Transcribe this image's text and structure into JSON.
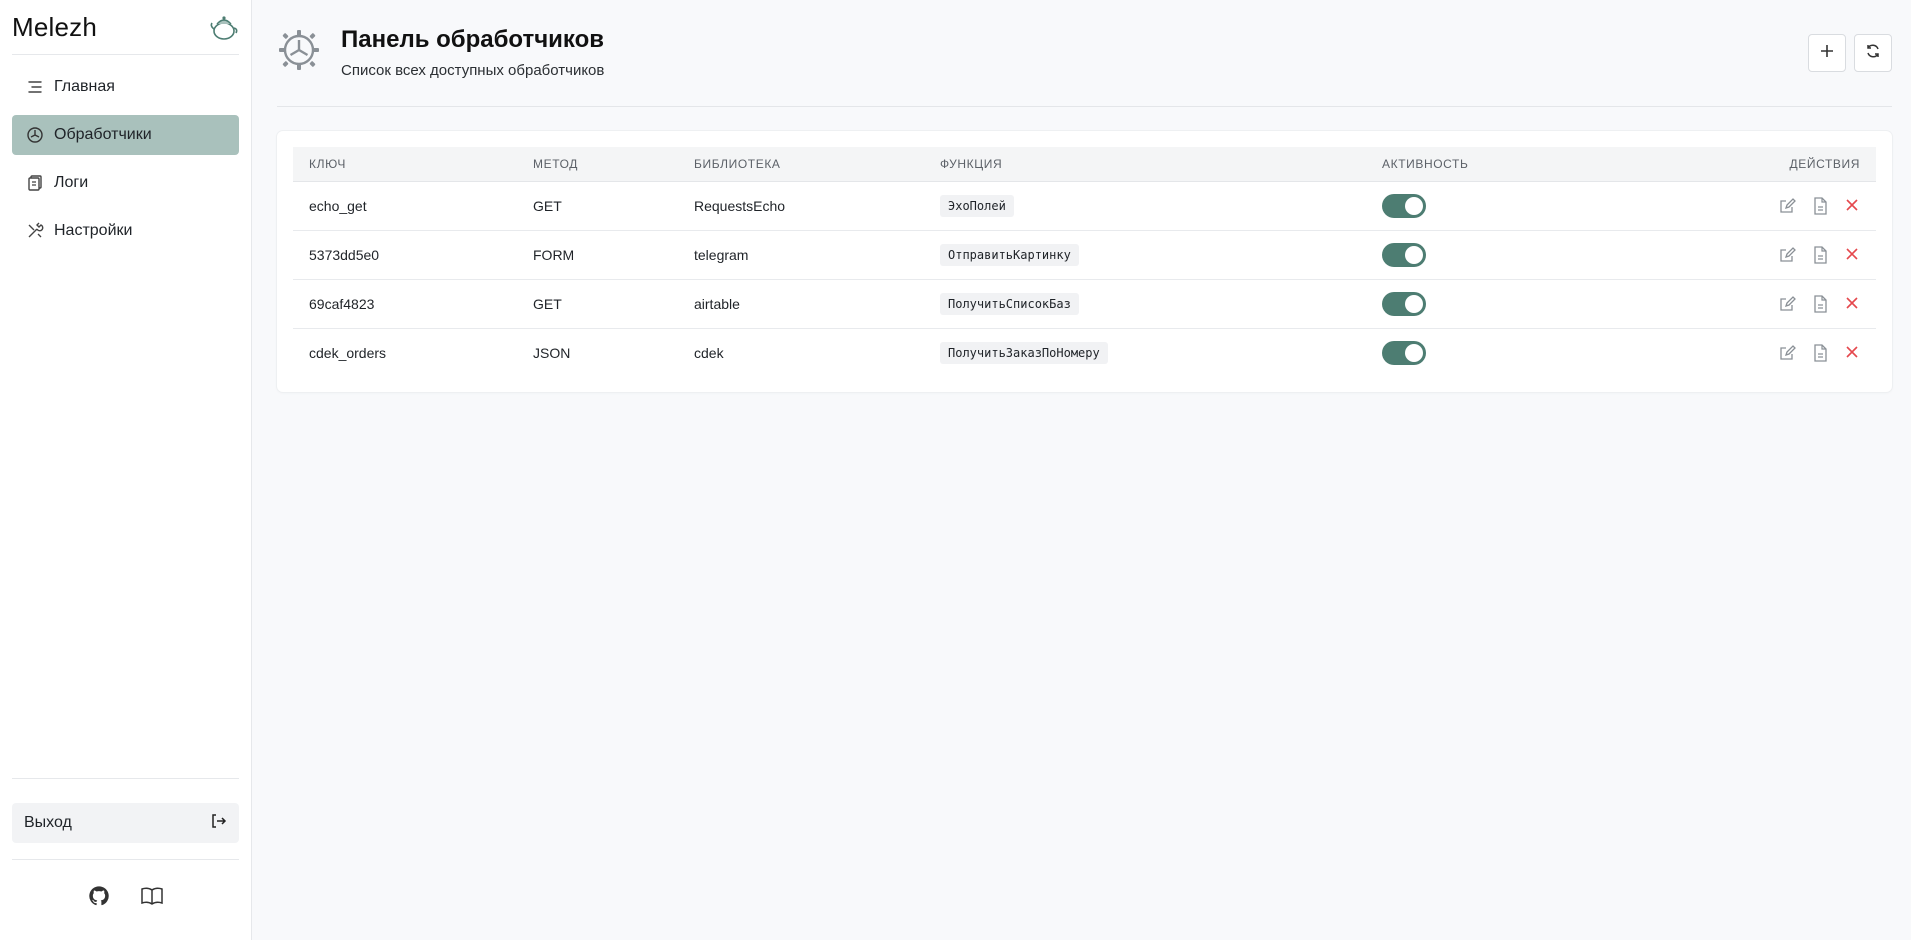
{
  "sidebar": {
    "brand": "Melezh",
    "items": [
      {
        "label": "Главная",
        "icon": "menu-lines-icon"
      },
      {
        "label": "Обработчики",
        "icon": "handler-icon",
        "active": true
      },
      {
        "label": "Логи",
        "icon": "logs-icon"
      },
      {
        "label": "Настройки",
        "icon": "tools-icon"
      }
    ],
    "logout_label": "Выход"
  },
  "header": {
    "title": "Панель обработчиков",
    "subtitle": "Список всех доступных обработчиков"
  },
  "table": {
    "columns": [
      "КЛЮЧ",
      "МЕТОД",
      "БИБЛИОТЕКА",
      "ФУНКЦИЯ",
      "АКТИВНОСТЬ",
      "ДЕЙСТВИЯ"
    ],
    "rows": [
      {
        "key": "echo_get",
        "method": "GET",
        "library": "RequestsEcho",
        "function": "ЭхоПолей",
        "active": true
      },
      {
        "key": "5373dd5e0",
        "method": "FORM",
        "library": "telegram",
        "function": "ОтправитьКартинку",
        "active": true
      },
      {
        "key": "69caf4823",
        "method": "GET",
        "library": "airtable",
        "function": "ПолучитьСписокБаз",
        "active": true
      },
      {
        "key": "cdek_orders",
        "method": "JSON",
        "library": "cdek",
        "function": "ПолучитьЗаказПоНомеру",
        "active": true
      }
    ]
  },
  "colors": {
    "accent": "#4d7d72",
    "active_nav": "#a9c1bc",
    "delete": "#e5484d"
  }
}
